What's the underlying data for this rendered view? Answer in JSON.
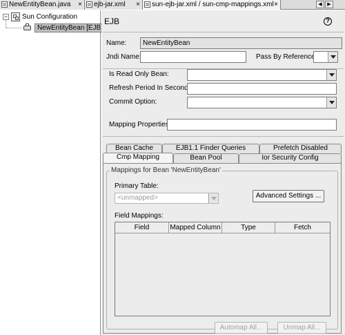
{
  "editor_tabs": [
    {
      "label": "NewEntityBean.java",
      "active": false
    },
    {
      "label": "ejb-jar.xml",
      "active": false
    },
    {
      "label": "sun-ejb-jar.xml / sun-cmp-mappings.xml",
      "active": true
    }
  ],
  "tab_close_glyph": "×",
  "nav_glyphs": {
    "prev": "◀",
    "next": "▶"
  },
  "tree": {
    "root_label": "Sun Configuration",
    "child_label": "NewEntityBean [EJB]",
    "expander_glyph": "−"
  },
  "panel": {
    "title": "EJB",
    "help_glyph": "?",
    "name_label": "Name:",
    "name_value": "NewEntityBean",
    "jndi_label": "Jndi Name:",
    "jndi_value": "",
    "pass_by_ref_label": "Pass By Reference:",
    "pass_by_ref_value": "",
    "read_only_label": "Is Read Only Bean:",
    "read_only_value": "",
    "refresh_label": "Refresh Period In Seconds:",
    "refresh_value": "",
    "commit_label": "Commit Option:",
    "commit_value": "",
    "mapping_props_label": "Mapping Properties:",
    "mapping_props_value": ""
  },
  "sub_tabs_row1": [
    "Bean Cache",
    "EJB1.1 Finder Queries",
    "Prefetch Disabled"
  ],
  "sub_tabs_row2": [
    "Cmp Mapping",
    "Bean Pool",
    "Ior Security Config"
  ],
  "selected_sub_tab": "Cmp Mapping",
  "mapping": {
    "group_title": "Mappings for Bean 'NewEntityBean'",
    "primary_table_label": "Primary Table:",
    "primary_table_value": "<unmapped>",
    "advanced_button": "Advanced Settings ...",
    "field_mappings_label": "Field Mappings:",
    "columns": [
      "Field",
      "Mapped Column",
      "Type",
      "Fetch"
    ],
    "automap_button": "Automap All...",
    "unmap_button": "Unmap All..."
  },
  "colors": {
    "panel_bg": "#ececec",
    "selection_bg": "#c0c0c0",
    "border": "#7a7a7a"
  }
}
